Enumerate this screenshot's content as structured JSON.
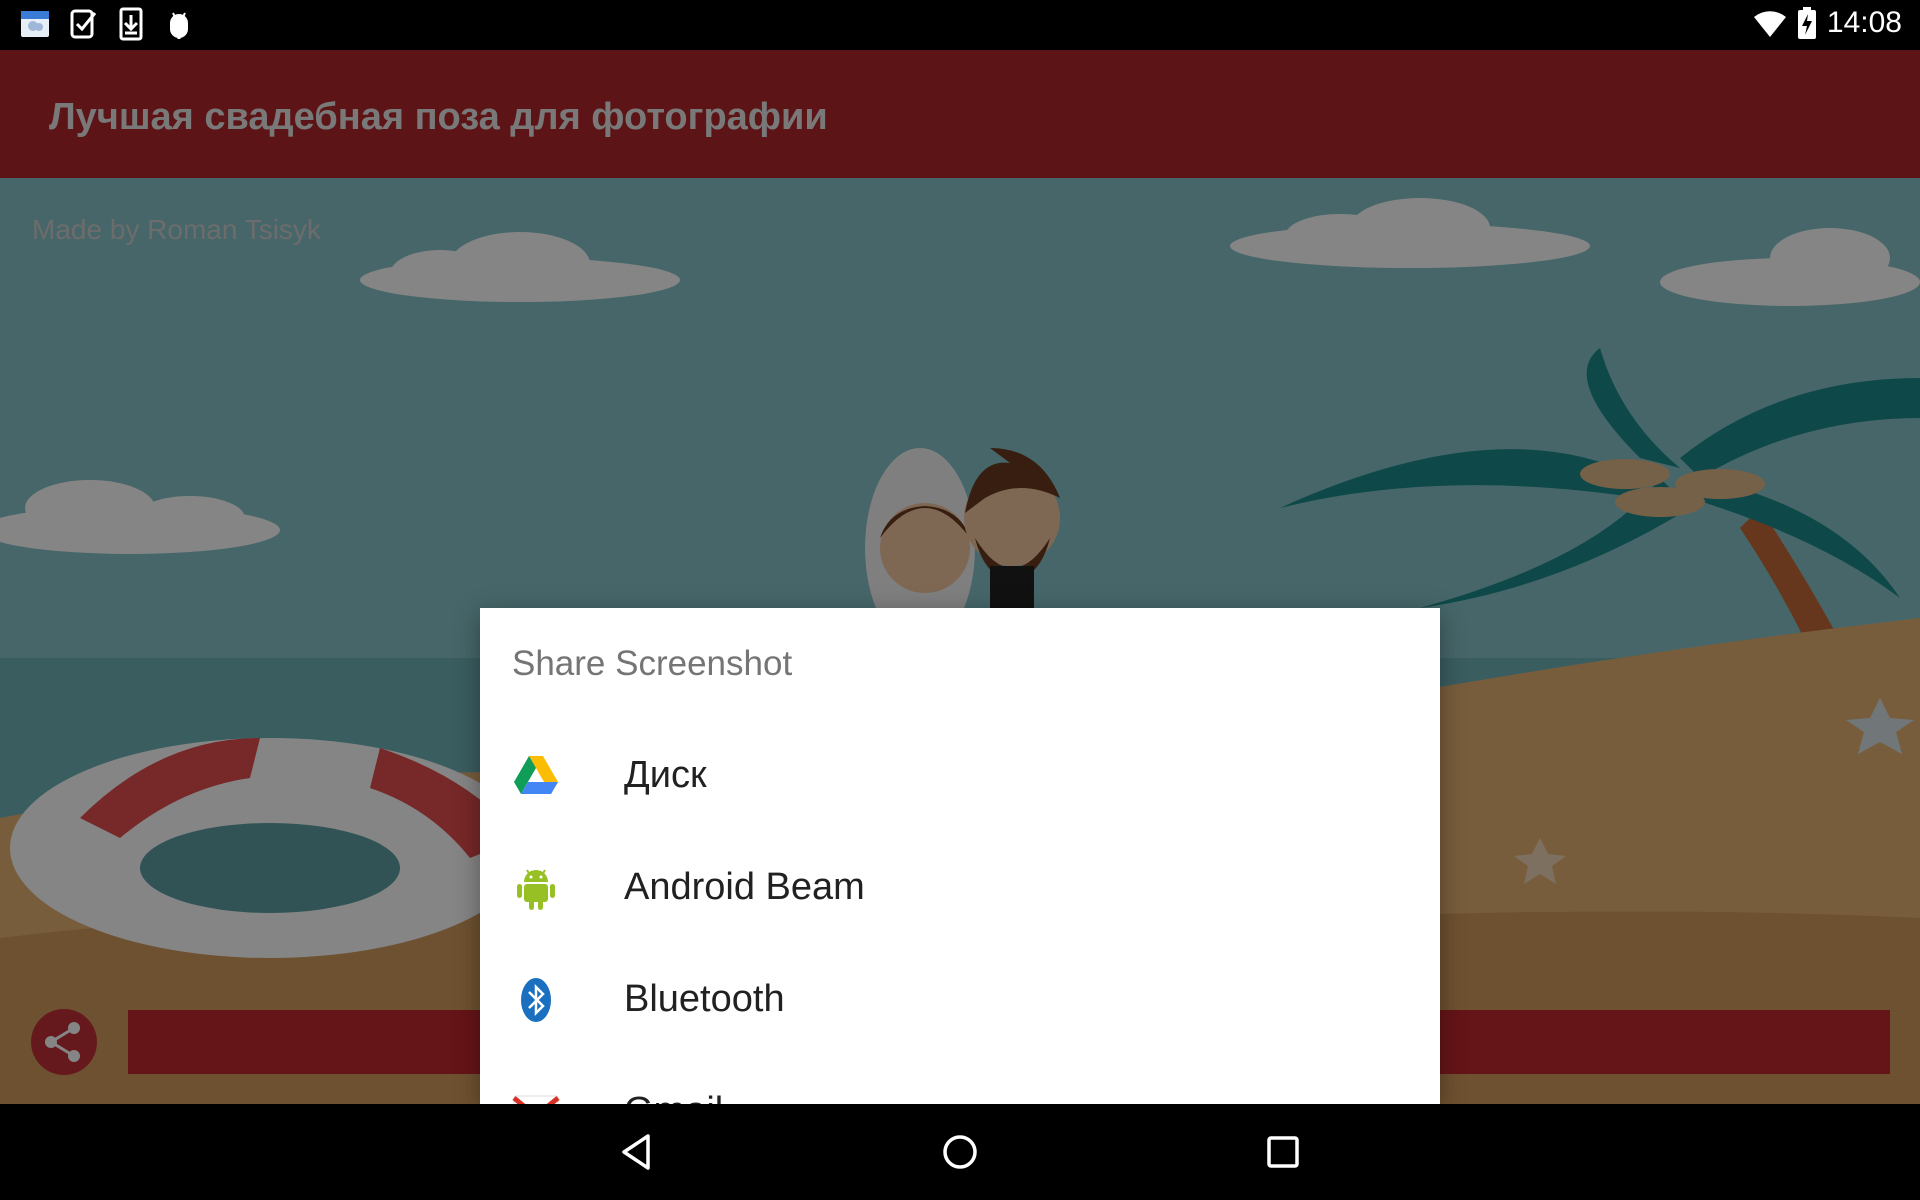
{
  "status_bar": {
    "time": "14:08",
    "left_icons": [
      "weather-app-icon",
      "task-checklist-icon",
      "download-icon",
      "android-debug-icon"
    ],
    "right_icons": [
      "wifi-icon",
      "battery-charging-icon"
    ]
  },
  "app_bar": {
    "title": "Лучшая свадебная поза для фотографии",
    "color": "#b3272d"
  },
  "content": {
    "credit": "Made by Roman Tsisyk",
    "share_button_icon": "share-icon"
  },
  "dialog": {
    "title": "Share Screenshot",
    "items": [
      {
        "label": "Диск",
        "icon": "google-drive-icon"
      },
      {
        "label": "Android Beam",
        "icon": "android-icon"
      },
      {
        "label": "Bluetooth",
        "icon": "bluetooth-icon"
      },
      {
        "label": "Gmail",
        "icon": "gmail-icon"
      }
    ]
  },
  "nav_bar": {
    "icons": [
      "back-icon",
      "home-icon",
      "recents-icon"
    ]
  }
}
